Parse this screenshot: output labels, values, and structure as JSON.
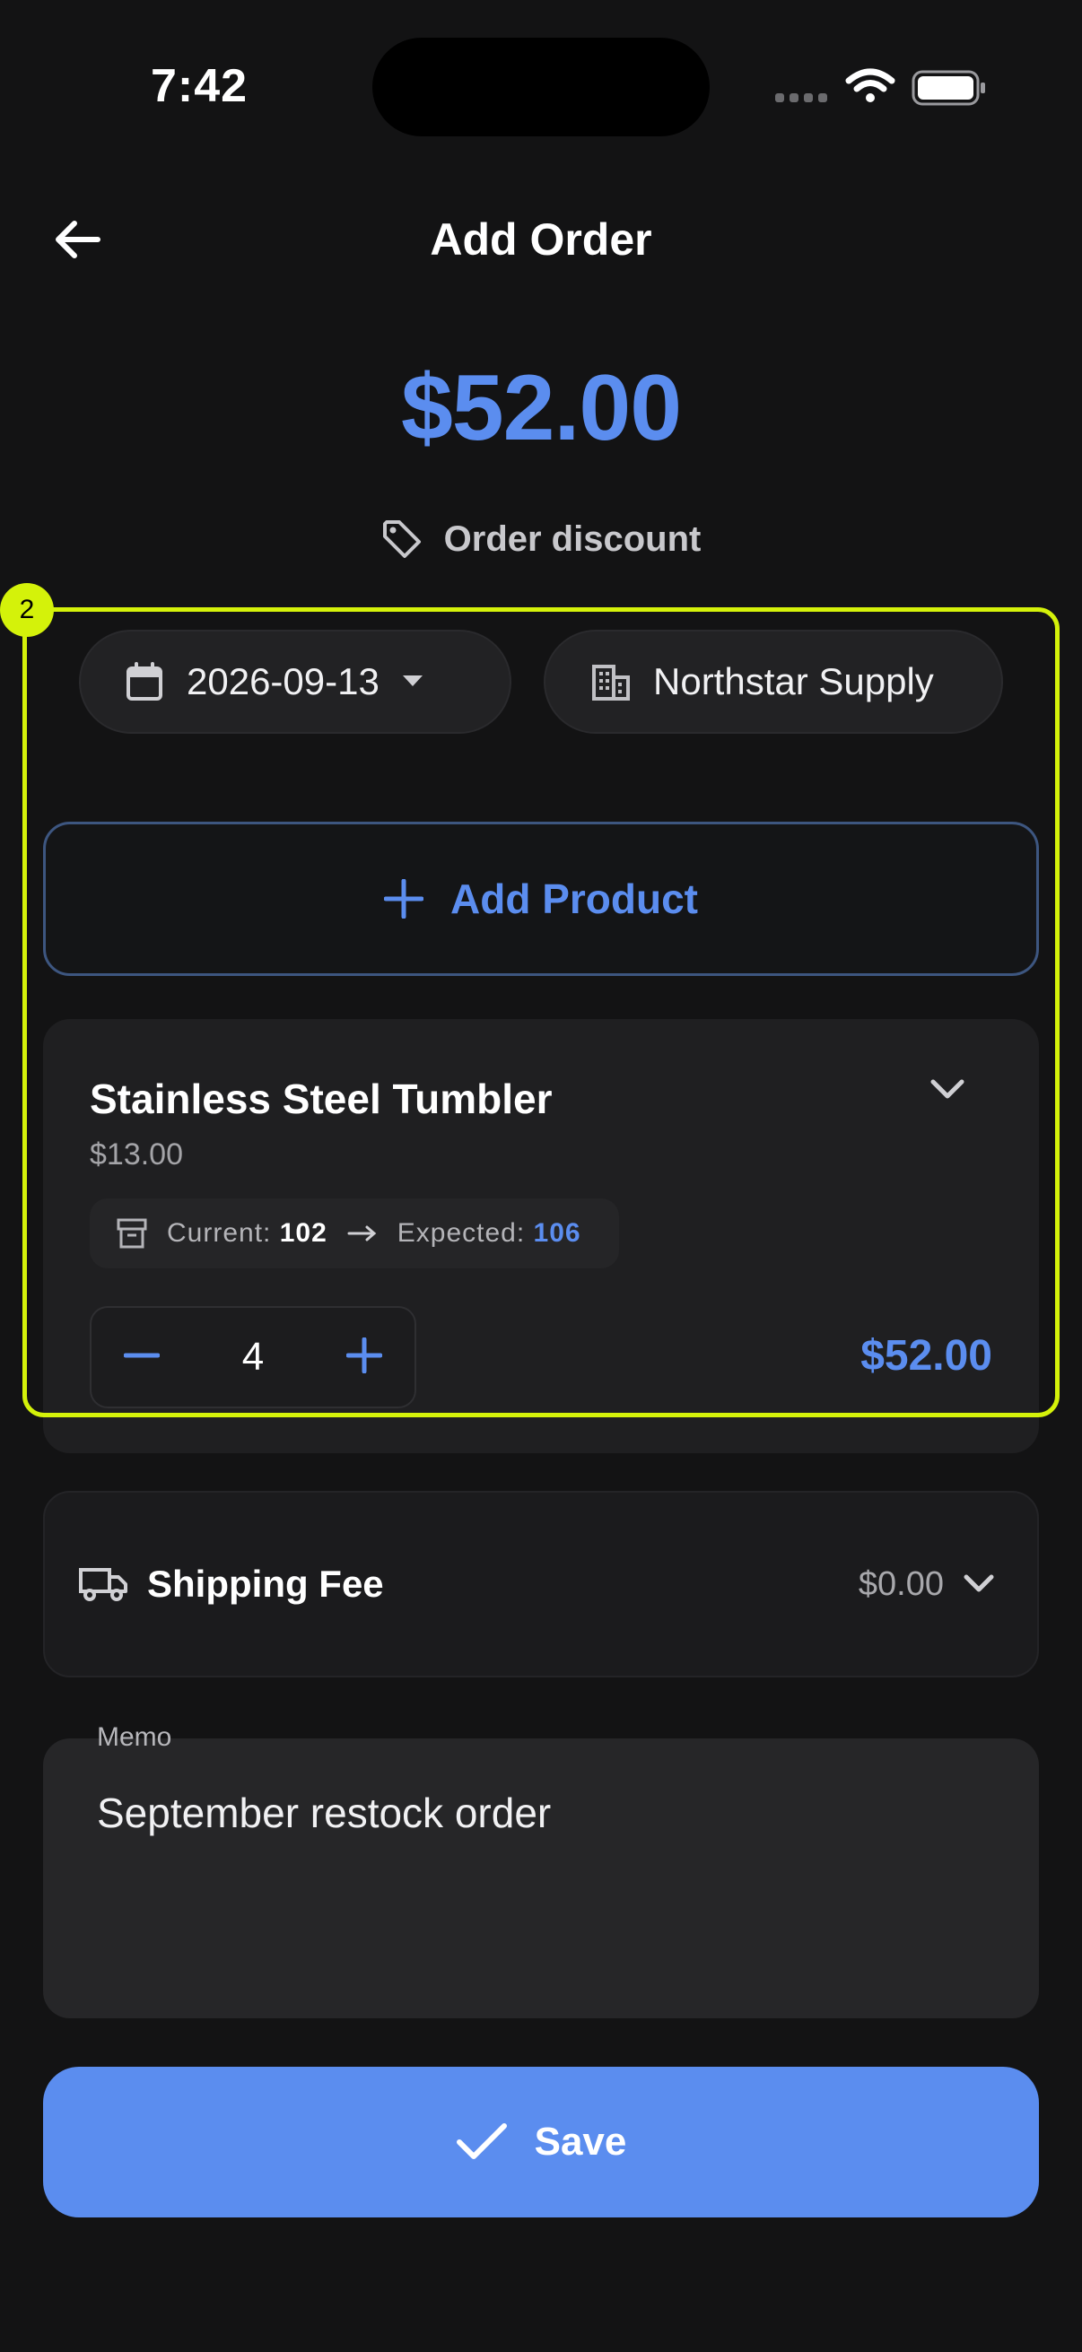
{
  "status_bar": {
    "time": "7:42"
  },
  "header": {
    "title": "Add Order"
  },
  "order": {
    "total": "$52.00",
    "discount_label": "Order discount"
  },
  "filters": {
    "date": "2026-09-13",
    "supplier": "Northstar Supply"
  },
  "add_product": {
    "label": "Add Product"
  },
  "product": {
    "name": "Stainless Steel Tumbler",
    "unit_price": "$13.00",
    "current_label": "Current:",
    "current_value": "102",
    "expected_label": "Expected:",
    "expected_value": "106",
    "quantity": "4",
    "line_total": "$52.00"
  },
  "selection": {
    "badge": "2"
  },
  "shipping": {
    "label": "Shipping Fee",
    "value": "$0.00"
  },
  "memo": {
    "label": "Memo",
    "value": "September restock order"
  },
  "save": {
    "label": "Save"
  },
  "colors": {
    "accent": "#5b8def",
    "highlight": "#d4f20a",
    "background": "#131314"
  },
  "icons": [
    "back-arrow-icon",
    "tag-icon",
    "calendar-icon",
    "dropdown-caret-icon",
    "building-icon",
    "plus-icon",
    "chevron-down-icon",
    "archive-icon",
    "arrow-right-icon",
    "minus-icon",
    "truck-icon",
    "check-icon"
  ]
}
